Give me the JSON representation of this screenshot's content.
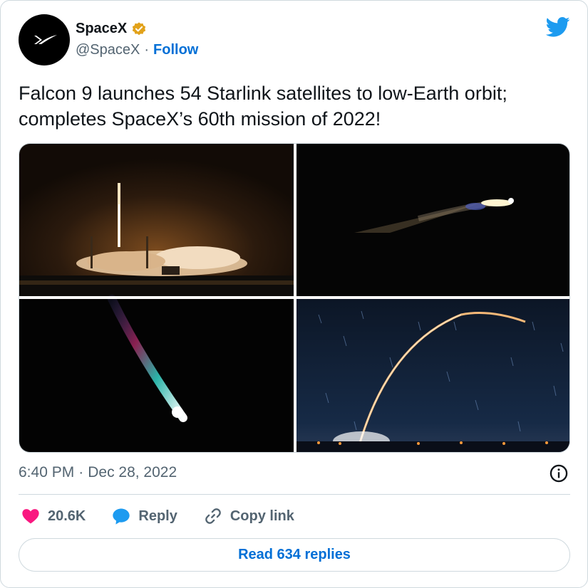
{
  "author": {
    "display_name": "SpaceX",
    "handle": "@SpaceX",
    "separator": "·",
    "follow_label": "Follow",
    "avatar_icon": "spacex-logo-icon",
    "verified_icon": "verified-badge-icon",
    "verified_color": "#e2a21a"
  },
  "platform_icon": "twitter-bird-icon",
  "tweet": {
    "text": "Falcon 9 launches 54 Starlink satellites to low-Earth orbit; completes SpaceX’s 60th mission of 2022!"
  },
  "media": {
    "count": 4,
    "icons": [
      "launch-photo",
      "night-flight-photo",
      "plume-photo",
      "arc-trail-photo"
    ]
  },
  "meta": {
    "time": "6:40 PM",
    "separator": "·",
    "date": "Dec 28, 2022",
    "info_icon": "info-icon"
  },
  "actions": {
    "like_count": "20.6K",
    "reply_label": "Reply",
    "copy_label": "Copy link",
    "like_color": "#f91880",
    "reply_color": "#1d9bf0"
  },
  "read_replies_label": "Read 634 replies",
  "colors": {
    "link_blue": "#006fd6",
    "text_primary": "#0f1419",
    "text_secondary": "#536471",
    "border": "#cfd9de"
  }
}
